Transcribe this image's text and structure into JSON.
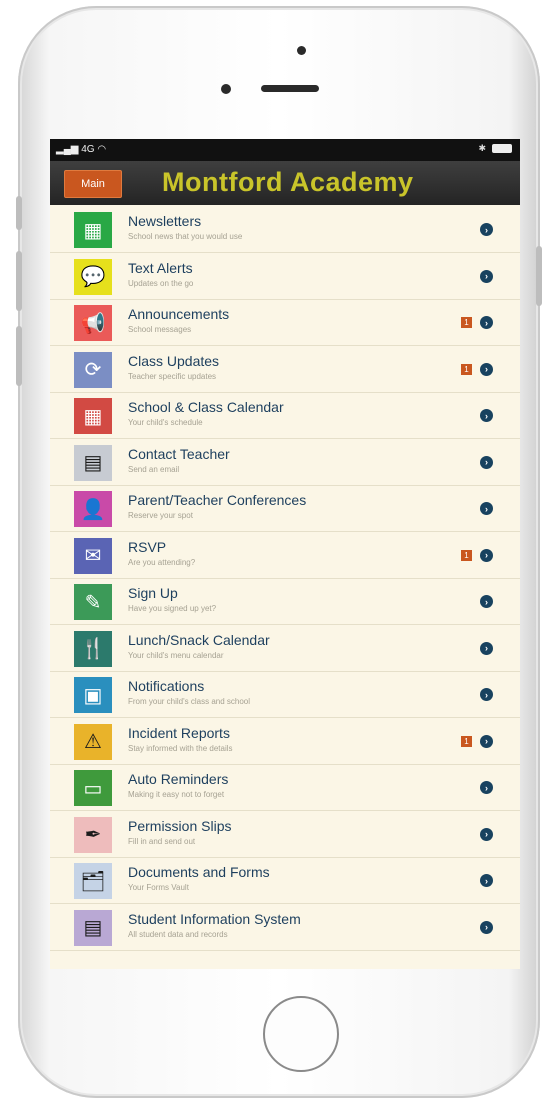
{
  "status": {
    "signal": "4G"
  },
  "navbar": {
    "main_label": "Main",
    "title": "Montford Academy"
  },
  "items": [
    {
      "title": "Newsletters",
      "subtitle": "School news that you would use",
      "icon": "newsletter-grid-icon",
      "color": "#29a845",
      "badge": ""
    },
    {
      "title": "Text Alerts",
      "subtitle": "Updates on the go",
      "icon": "speech-bubble-icon",
      "color": "#e6e01c",
      "badge": ""
    },
    {
      "title": "Announcements",
      "subtitle": "School messages",
      "icon": "megaphone-icon",
      "color": "#ea5a58",
      "badge": "1"
    },
    {
      "title": "Class Updates",
      "subtitle": "Teacher specific updates",
      "icon": "refresh-arrows-icon",
      "color": "#7b8ec4",
      "badge": "1"
    },
    {
      "title": "School & Class Calendar",
      "subtitle": "Your child's schedule",
      "icon": "calendar-icon",
      "color": "#d24a43",
      "badge": ""
    },
    {
      "title": "Contact Teacher",
      "subtitle": "Send an email",
      "icon": "contact-card-icon",
      "color": "#c7cbd2",
      "badge": ""
    },
    {
      "title": "Parent/Teacher Conferences",
      "subtitle": "Reserve your spot",
      "icon": "person-silhouette-icon",
      "color": "#c94aa8",
      "badge": ""
    },
    {
      "title": "RSVP",
      "subtitle": "Are you attending?",
      "icon": "envelope-icon",
      "color": "#5a64b4",
      "badge": "1"
    },
    {
      "title": "Sign Up",
      "subtitle": "Have you signed up yet?",
      "icon": "edit-pencil-icon",
      "color": "#3c9a58",
      "badge": ""
    },
    {
      "title": "Lunch/Snack Calendar",
      "subtitle": "Your child's menu calendar",
      "icon": "fork-knife-icon",
      "color": "#2c7a6c",
      "badge": ""
    },
    {
      "title": "Notifications",
      "subtitle": "From your child's class and school",
      "icon": "notification-board-icon",
      "color": "#2a8fbe",
      "badge": ""
    },
    {
      "title": "Incident Reports",
      "subtitle": "Stay informed with the details",
      "icon": "warning-triangle-icon",
      "color": "#e9b32a",
      "badge": "1"
    },
    {
      "title": "Auto Reminders",
      "subtitle": "Making it easy not to forget",
      "icon": "inbox-tray-icon",
      "color": "#3f9a3c",
      "badge": ""
    },
    {
      "title": "Permission Slips",
      "subtitle": "Fill in and send out",
      "icon": "pen-icon",
      "color": "#eebcbc",
      "badge": ""
    },
    {
      "title": "Documents and Forms",
      "subtitle": "Your Forms Vault",
      "icon": "folder-documents-icon",
      "color": "#c5d3e6",
      "badge": ""
    },
    {
      "title": "Student Information System",
      "subtitle": "All student data and records",
      "icon": "id-card-icon",
      "color": "#b9a8d4",
      "badge": ""
    }
  ]
}
